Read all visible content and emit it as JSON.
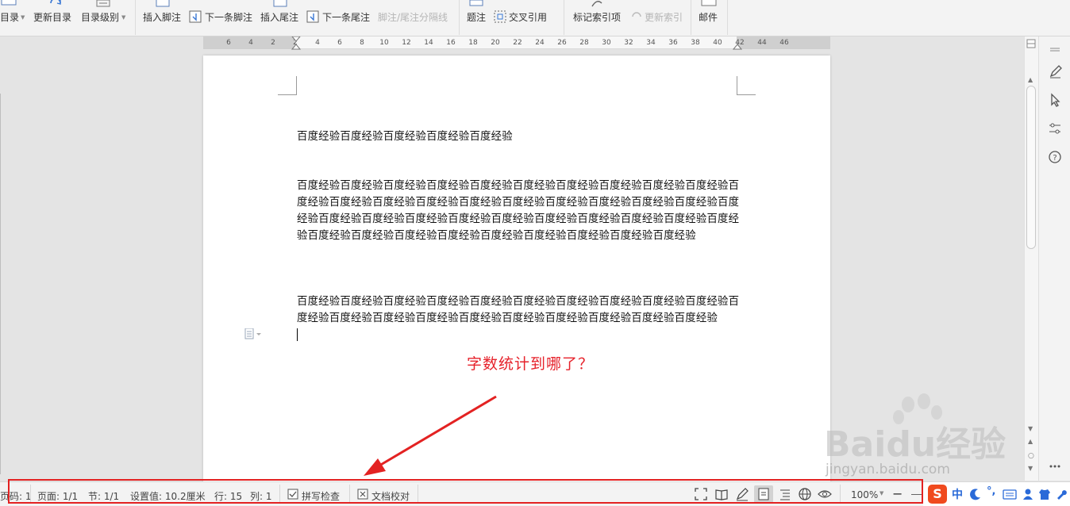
{
  "ribbon": {
    "toc_label": "目录",
    "update_toc_label": "更新目录",
    "toc_level_label": "目录级别",
    "insert_footnote_label": "插入脚注",
    "next_footnote_label": "下一条脚注",
    "insert_endnote_label": "插入尾注",
    "next_endnote_label": "下一条尾注",
    "separator_label": "脚注/尾注分隔线",
    "caption_label": "题注",
    "cross_ref_label": "交叉引用",
    "mark_index_label": "标记索引项",
    "update_index_label": "更新索引",
    "mail_label": "邮件"
  },
  "ruler": {
    "ticks": [
      "6",
      "4",
      "2",
      "2",
      "4",
      "6",
      "8",
      "10",
      "12",
      "14",
      "16",
      "18",
      "20",
      "22",
      "24",
      "26",
      "28",
      "30",
      "32",
      "34",
      "36",
      "38",
      "40",
      "42",
      "44",
      "46"
    ]
  },
  "document": {
    "paragraphs": [
      "百度经验百度经验百度经验百度经验百度经验",
      "百度经验百度经验百度经验百度经验百度经验百度经验百度经验百度经验百度经验百度经验百度经验百度经验百度经验百度经验百度经验百度经验百度经验百度经验百度经验百度经验百度经验百度经验百度经验百度经验百度经验百度经验百度经验百度经验百度经验百度经验百度经验百度经验百度经验百度经验百度经验百度经验百度经验百度经验百度经验百度经验",
      "百度经验百度经验百度经验百度经验百度经验百度经验百度经验百度经验百度经验百度经验百度经验百度经验百度经验百度经验百度经验百度经验百度经验百度经验百度经验百度经验"
    ]
  },
  "annotation": {
    "question": "字数统计到哪了？",
    "color": "#e6222b"
  },
  "status": {
    "page_no": "页码: 1",
    "pages": "页面: 1/1",
    "section": "节: 1/1",
    "setting": "设置值: 10.2厘米",
    "row": "行: 15",
    "col": "列: 1",
    "spell_check": "拼写检查",
    "doc_proof": "文档校对",
    "zoom": "100%"
  },
  "watermark": {
    "brand": "Bai",
    "brand2": "du",
    "brand3": "经验",
    "url": "jingyan.baidu.com"
  },
  "ime": {
    "logo": "S",
    "lang": "中"
  },
  "colors": {
    "accent_red": "#e32222"
  }
}
